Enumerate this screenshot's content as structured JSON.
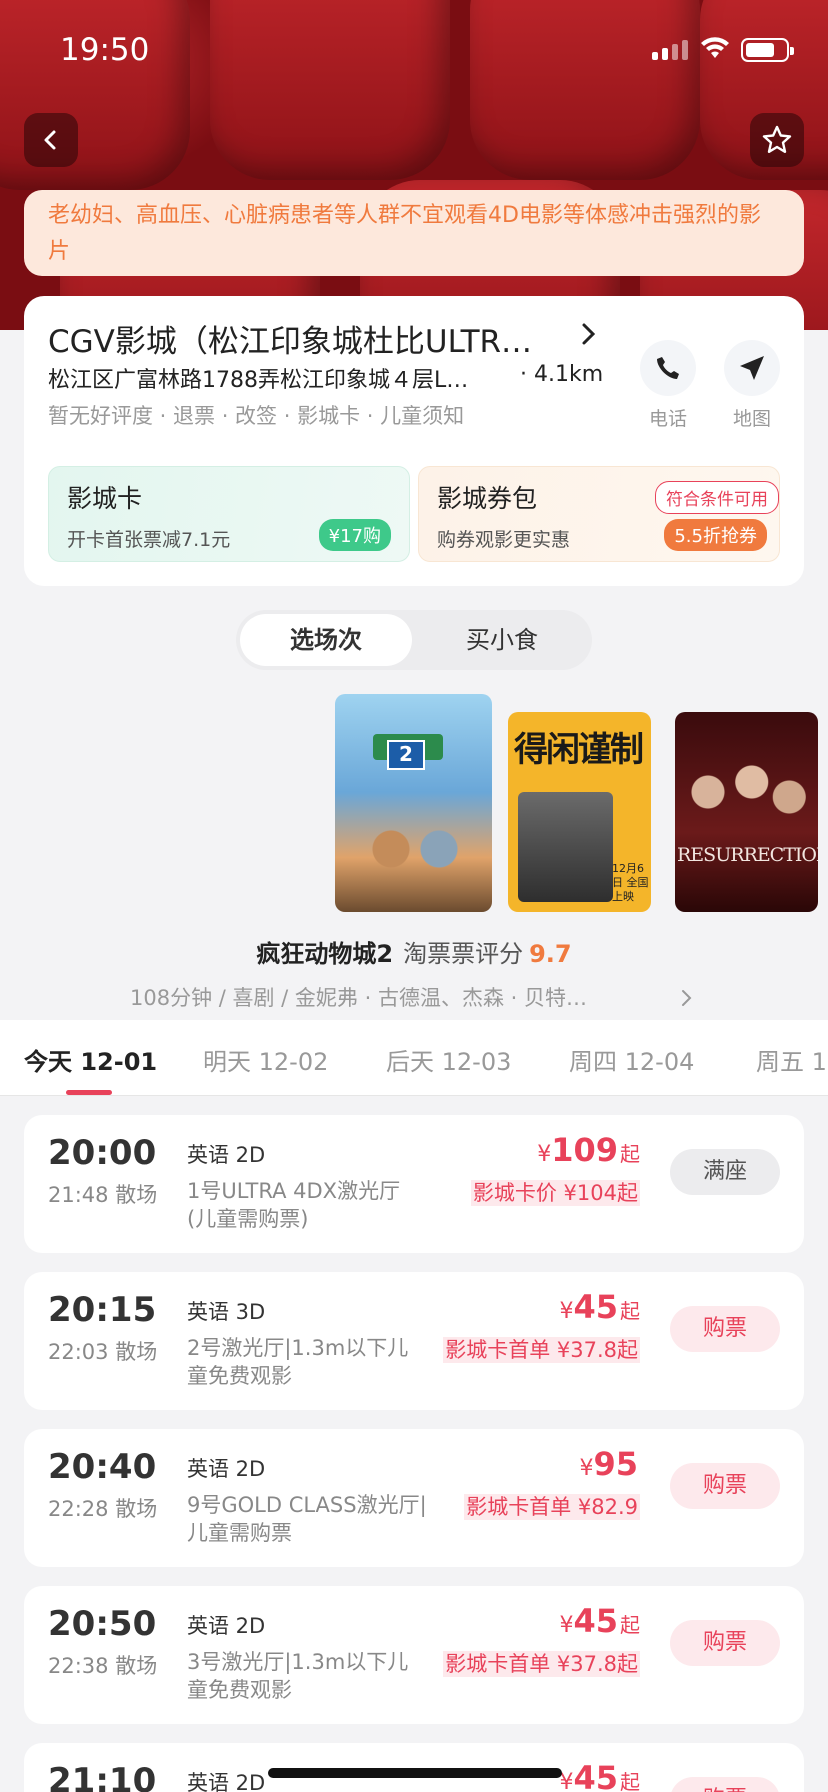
{
  "status_bar": {
    "time": "19:50"
  },
  "warning": "老幼妇、高血压、心脏病患者等人群不宜观看4D电影等体感冲击强烈的影片",
  "cinema": {
    "name": "CGV影城（松江印象城杜比ULTR…",
    "address": "松江区广富林路1788弄松江印象城４层L…",
    "distance": "· 4.1km",
    "tags": "暂无好评度 · 退票 · 改签 · 影城卡 · 儿童须知",
    "phone_label": "电话",
    "map_label": "地图"
  },
  "promos": {
    "card": {
      "title": "影城卡",
      "subtitle": "开卡首张票减7.1元",
      "pill": "¥17购"
    },
    "coupon": {
      "title": "影城券包",
      "subtitle": "购券观影更实惠",
      "badge": "符合条件可用",
      "pill": "5.5折抢券"
    }
  },
  "tabs": [
    "选场次",
    "买小食"
  ],
  "movie": {
    "title": "疯狂动物城2",
    "rating_label": "淘票票评分",
    "rating": "9.7",
    "info": "108分钟 / 喜剧 / 金妮弗 · 古德温、杰森 · 贝特…",
    "poster2_title": "得闲谨制",
    "poster2_date": "12月6日 全国上映",
    "poster3_title": "RESURRECTION"
  },
  "dates": [
    "今天 12-01",
    "明天  12-02",
    "后天  12-03",
    "周四  12-04",
    "周五  1"
  ],
  "showtimes": [
    {
      "start": "20:00",
      "end": "21:48 散场",
      "lang": "英语 2D",
      "hall": "1号ULTRA 4DX激光厅(儿童需购票)",
      "yen": "¥",
      "price": "109",
      "qi": "起",
      "discount": "影城卡价 ¥104起",
      "action": "满座"
    },
    {
      "start": "20:15",
      "end": "22:03 散场",
      "lang": "英语 3D",
      "hall": "2号激光厅|1.3m以下儿童免费观影",
      "yen": "¥",
      "price": "45",
      "qi": "起",
      "discount": "影城卡首单 ¥37.8起",
      "action": "购票"
    },
    {
      "start": "20:40",
      "end": "22:28 散场",
      "lang": "英语 2D",
      "hall": "9号GOLD CLASS激光厅|儿童需购票",
      "yen": "¥",
      "price": "95",
      "qi": "",
      "discount": "影城卡首单 ¥82.9",
      "action": "购票"
    },
    {
      "start": "20:50",
      "end": "22:38 散场",
      "lang": "英语 2D",
      "hall": "3号激光厅|1.3m以下儿童免费观影",
      "yen": "¥",
      "price": "45",
      "qi": "起",
      "discount": "影城卡首单 ¥37.8起",
      "action": "购票"
    },
    {
      "start": "21:10",
      "end": "",
      "lang": "英语 2D",
      "hall": "",
      "yen": "¥",
      "price": "45",
      "qi": "起",
      "discount": "",
      "action": "购票"
    }
  ],
  "colors": {
    "accent": "#e8425a",
    "orange": "#f07a3e",
    "green": "#3ec98a"
  }
}
